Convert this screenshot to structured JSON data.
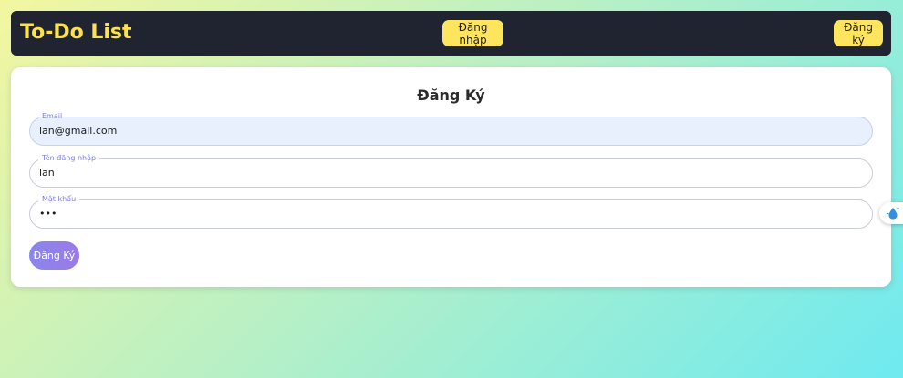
{
  "header": {
    "brand": "To-Do List",
    "login_label": "Đăng nhập",
    "register_label": "Đăng ký"
  },
  "form": {
    "title": "Đăng Ký",
    "email": {
      "label": "Email",
      "value": "lan@gmail.com"
    },
    "username": {
      "label": "Tên đăng nhập",
      "value": "lan"
    },
    "password": {
      "label": "Mật khẩu",
      "value": "•••"
    },
    "submit_label": "Đăng Ký"
  },
  "side_widget": {
    "icon": "water-drop-icon"
  },
  "colors": {
    "navbar_bg": "#1f2430",
    "brand": "#ffe14d",
    "nav_button_bg": "#ffe45e",
    "label_accent": "#7c7ce0",
    "submit_gradient_start": "#8a86ec",
    "submit_gradient_end": "#9b7ae6"
  }
}
